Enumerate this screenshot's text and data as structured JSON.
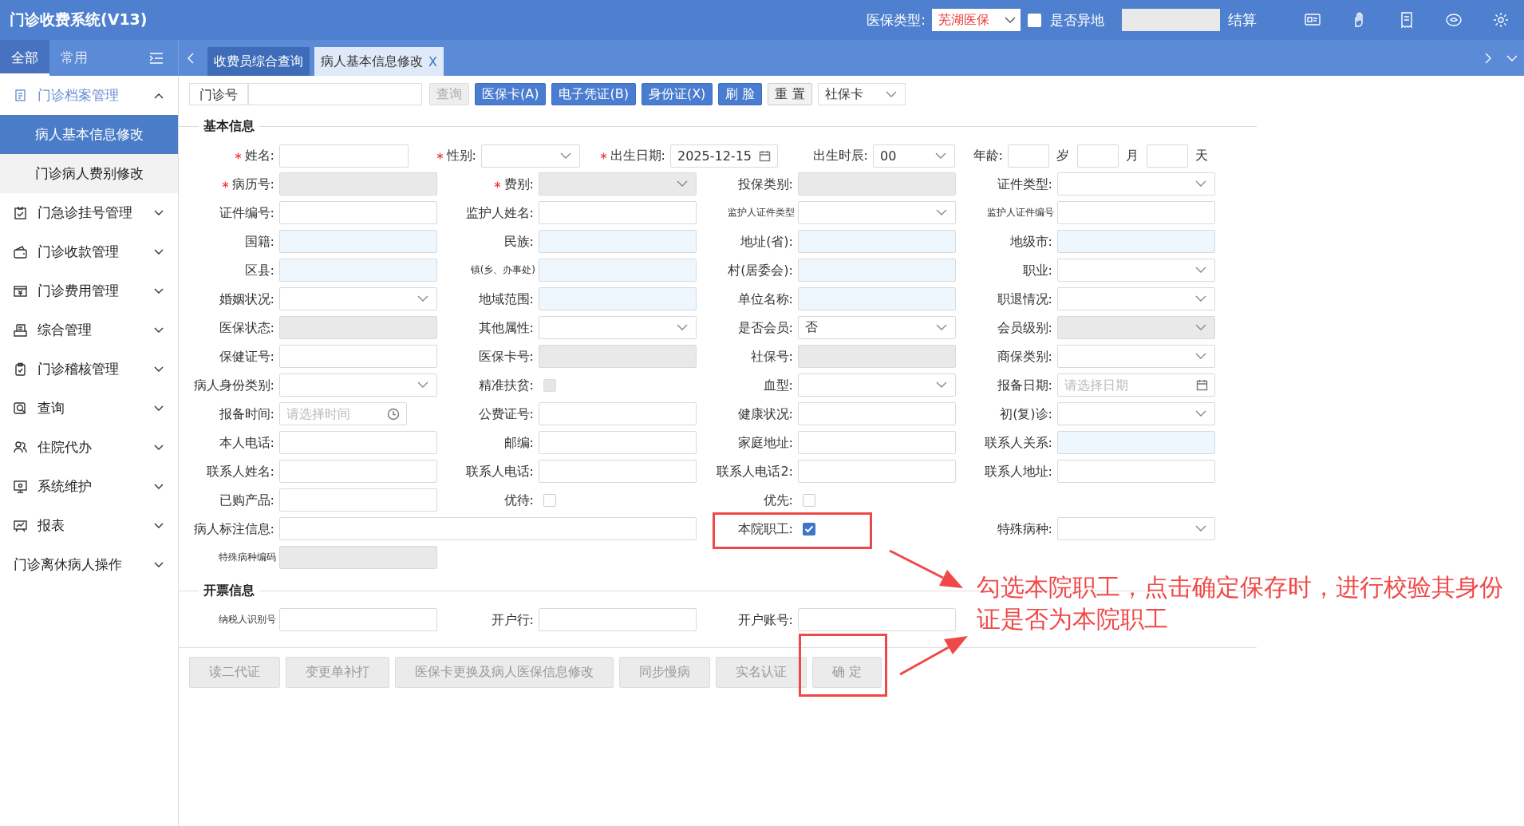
{
  "header": {
    "title": "门诊收费系统(V13)",
    "insurance_label": "医保类型:",
    "insurance_value": "芜湖医保",
    "remote": {
      "label": "是否异地",
      "checked": false
    },
    "settle_label": "结算"
  },
  "nav": {
    "sidebar_tabs": [
      {
        "label": "全部",
        "selected": true
      },
      {
        "label": "常用",
        "selected": false
      }
    ],
    "tabs": [
      {
        "label": "收费员综合查询",
        "selected": false
      },
      {
        "label": "病人基本信息修改",
        "selected": true,
        "close": "X"
      }
    ]
  },
  "sidebar": {
    "items": [
      {
        "label": "门诊档案管理",
        "expanded": true,
        "children": [
          {
            "label": "病人基本信息修改",
            "selected": true
          },
          {
            "label": "门诊病人费别修改",
            "selected": false
          }
        ]
      },
      {
        "label": "门急诊挂号管理",
        "expanded": false
      },
      {
        "label": "门诊收款管理",
        "expanded": false
      },
      {
        "label": "门诊费用管理",
        "expanded": false
      },
      {
        "label": "综合管理",
        "expanded": false
      },
      {
        "label": "门诊稽核管理",
        "expanded": false
      },
      {
        "label": "查询",
        "expanded": false
      },
      {
        "label": "住院代办",
        "expanded": false
      },
      {
        "label": "系统维护",
        "expanded": false
      },
      {
        "label": "报表",
        "expanded": false
      },
      {
        "label": "门诊离休病人操作",
        "expanded": false
      }
    ]
  },
  "toolbar": {
    "label": "门诊号",
    "buttons": [
      {
        "label": "查询",
        "kind": "command",
        "disabled": true
      },
      {
        "label": "医保卡(A)",
        "kind": "reader",
        "disabled": false
      },
      {
        "label": "电子凭证(B)",
        "kind": "reader",
        "disabled": false
      },
      {
        "label": "身份证(X)",
        "kind": "reader",
        "disabled": false
      },
      {
        "label": "刷 脸",
        "kind": "reader",
        "disabled": false
      },
      {
        "label": "重 置",
        "kind": "command",
        "disabled": false
      }
    ],
    "card_type": "社保卡"
  },
  "basic_info": {
    "title": "基本信息",
    "top_row": [
      {
        "label": "姓名:",
        "required": true,
        "kind": "text"
      },
      {
        "label": "性别:",
        "required": true,
        "kind": "select"
      },
      {
        "label": "出生日期:",
        "required": true,
        "kind": "date",
        "value": "2025-12-15"
      },
      {
        "label": "出生时辰:",
        "kind": "select",
        "value": "00"
      },
      {
        "label": "年龄:",
        "kind": "age",
        "units": [
          "岁",
          "月",
          "天"
        ]
      }
    ],
    "rows": [
      [
        {
          "label": "病历号:",
          "required": true,
          "kind": "text",
          "disabled": true
        },
        {
          "label": "费别:",
          "required": true,
          "kind": "select",
          "disabled": true
        },
        {
          "label": "投保类别:",
          "kind": "text",
          "disabled": true
        },
        {
          "label": "证件类型:",
          "kind": "select"
        }
      ],
      [
        {
          "label": "证件编号:",
          "kind": "text"
        },
        {
          "label": "监护人姓名:",
          "kind": "text"
        },
        {
          "label": "监护人证件类型",
          "compact": true,
          "kind": "select"
        },
        {
          "label": "监护人证件编号",
          "compact": true,
          "kind": "text"
        }
      ],
      [
        {
          "label": "国籍:",
          "kind": "lookup"
        },
        {
          "label": "民族:",
          "kind": "lookup"
        },
        {
          "label": "地址(省):",
          "kind": "lookup"
        },
        {
          "label": "地级市:",
          "kind": "lookup"
        }
      ],
      [
        {
          "label": "区县:",
          "kind": "lookup"
        },
        {
          "label": "镇(乡、办事处)",
          "compact": true,
          "kind": "lookup"
        },
        {
          "label": "村(居委会):",
          "kind": "lookup"
        },
        {
          "label": "职业:",
          "kind": "select"
        }
      ],
      [
        {
          "label": "婚姻状况:",
          "kind": "select"
        },
        {
          "label": "地域范围:",
          "kind": "lookup"
        },
        {
          "label": "单位名称:",
          "kind": "lookup"
        },
        {
          "label": "职退情况:",
          "kind": "select"
        }
      ],
      [
        {
          "label": "医保状态:",
          "kind": "text",
          "disabled": true
        },
        {
          "label": "其他属性:",
          "kind": "select"
        },
        {
          "label": "是否会员:",
          "kind": "select",
          "value": "否"
        },
        {
          "label": "会员级别:",
          "kind": "select",
          "disabled": true
        }
      ],
      [
        {
          "label": "保健证号:",
          "kind": "text"
        },
        {
          "label": "医保卡号:",
          "kind": "text",
          "disabled": true
        },
        {
          "label": "社保号:",
          "kind": "text",
          "disabled": true
        },
        {
          "label": "商保类别:",
          "kind": "select"
        }
      ],
      [
        {
          "label": "病人身份类别:",
          "kind": "select"
        },
        {
          "label": "精准扶贫:",
          "kind": "checkbox",
          "checked": false,
          "disabled": true
        },
        {
          "label": "血型:",
          "kind": "select"
        },
        {
          "label": "报备日期:",
          "kind": "date",
          "placeholder": "请选择日期"
        }
      ],
      [
        {
          "label": "报备时间:",
          "kind": "time",
          "placeholder": "请选择时间"
        },
        {
          "label": "公费证号:",
          "kind": "text"
        },
        {
          "label": "健康状况:",
          "kind": "text"
        },
        {
          "label": "初(复)诊:",
          "kind": "select"
        }
      ],
      [
        {
          "label": "本人电话:",
          "kind": "text"
        },
        {
          "label": "邮编:",
          "kind": "text"
        },
        {
          "label": "家庭地址:",
          "kind": "text"
        },
        {
          "label": "联系人关系:",
          "kind": "lookup"
        }
      ],
      [
        {
          "label": "联系人姓名:",
          "kind": "text"
        },
        {
          "label": "联系人电话:",
          "kind": "text"
        },
        {
          "label": "联系人电话2:",
          "kind": "text"
        },
        {
          "label": "联系人地址:",
          "kind": "text"
        }
      ],
      [
        {
          "label": "已购产品:",
          "kind": "text"
        },
        {
          "label": "优待:",
          "kind": "checkbox",
          "checked": false,
          "disabled": false
        },
        {
          "label": "优先:",
          "kind": "checkbox",
          "checked": false,
          "disabled": false
        }
      ],
      [
        {
          "label": "病人标注信息:",
          "kind": "longtext"
        },
        "",
        {
          "label": "本院职工:",
          "kind": "checkbox",
          "checked": true,
          "disabled": false
        },
        {
          "label": "特殊病种:",
          "kind": "select"
        }
      ],
      [
        {
          "label": "特殊病种编码",
          "compact": true,
          "kind": "text",
          "disabled": true
        }
      ]
    ]
  },
  "billing": {
    "title": "开票信息",
    "rows": [
      [
        {
          "label": "纳税人识别号",
          "compact": true,
          "kind": "text"
        },
        {
          "label": "开户行:",
          "kind": "text"
        },
        {
          "label": "开户账号:",
          "kind": "text"
        }
      ]
    ]
  },
  "actions": [
    {
      "label": "读二代证",
      "disabled": true
    },
    {
      "label": "变更单补打",
      "disabled": true
    },
    {
      "label": "医保卡更换及病人医保信息修改",
      "disabled": true
    },
    {
      "label": "同步慢病",
      "disabled": true
    },
    {
      "label": "实名认证",
      "disabled": true
    },
    {
      "label": "确 定",
      "disabled": true
    }
  ],
  "annotation": {
    "text": "勾选本院职工，点击确定保存时，进行校验其身份证是否为本院职工"
  }
}
